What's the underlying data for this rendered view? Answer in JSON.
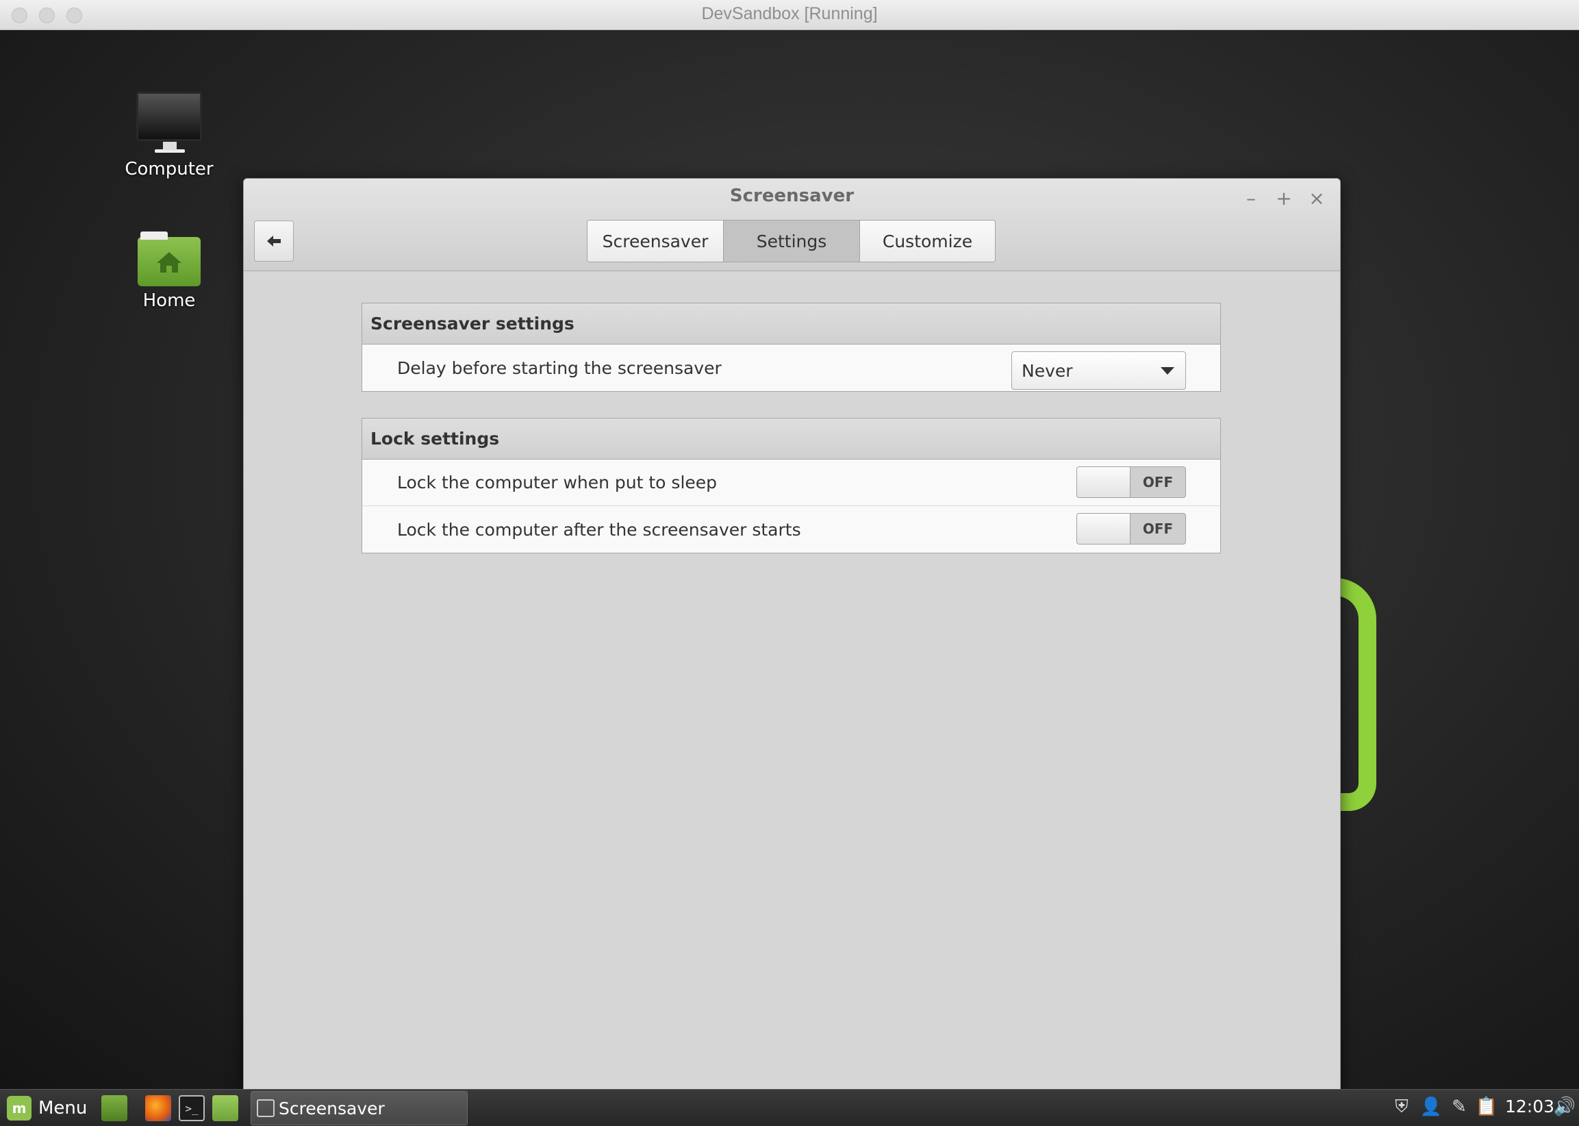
{
  "host": {
    "title": "DevSandbox [Running]"
  },
  "desktop": {
    "icons": [
      {
        "label": "Computer",
        "icon": "computer-icon"
      },
      {
        "label": "Home",
        "icon": "home-folder-icon"
      }
    ]
  },
  "window": {
    "title": "Screensaver",
    "controls": {
      "minimize": "–",
      "maximize": "+",
      "close": "×"
    },
    "back_icon": "◆",
    "tabs": [
      {
        "label": "Screensaver",
        "active": false
      },
      {
        "label": "Settings",
        "active": true
      },
      {
        "label": "Customize",
        "active": false
      }
    ],
    "sections": [
      {
        "title": "Screensaver settings",
        "rows": [
          {
            "label": "Delay before starting the screensaver",
            "control": "combo",
            "value": "Never"
          }
        ]
      },
      {
        "title": "Lock settings",
        "rows": [
          {
            "label": "Lock the computer when put to sleep",
            "control": "switch",
            "value": "OFF"
          },
          {
            "label": "Lock the computer after the screensaver starts",
            "control": "switch",
            "value": "OFF"
          }
        ]
      }
    ]
  },
  "taskbar": {
    "menu_label": "Menu",
    "task_item": "Screensaver",
    "clock": "12:03"
  },
  "colors": {
    "mint_green": "#8fc24f",
    "window_bg": "#d6d6d6"
  }
}
